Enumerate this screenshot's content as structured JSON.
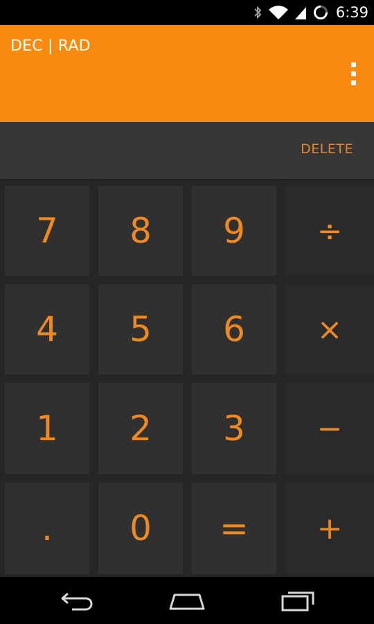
{
  "status_bar": {
    "time": "6:39",
    "icons": [
      "bluetooth-icon",
      "wifi-icon",
      "cell-signal-icon",
      "sync-icon"
    ]
  },
  "display": {
    "mode": "DEC | RAD",
    "background": "#f78a0f",
    "menu_icon": "overflow-menu-icon"
  },
  "delete_label": "DELETE",
  "accent": "#ef8a22",
  "keys": {
    "k7": "7",
    "k8": "8",
    "k9": "9",
    "div": "÷",
    "k4": "4",
    "k5": "5",
    "k6": "6",
    "mul": "×",
    "k1": "1",
    "k2": "2",
    "k3": "3",
    "sub": "−",
    "dot": ".",
    "k0": "0",
    "eq": "=",
    "add": "+"
  },
  "nav": [
    "back-icon",
    "home-icon",
    "recent-apps-icon"
  ]
}
